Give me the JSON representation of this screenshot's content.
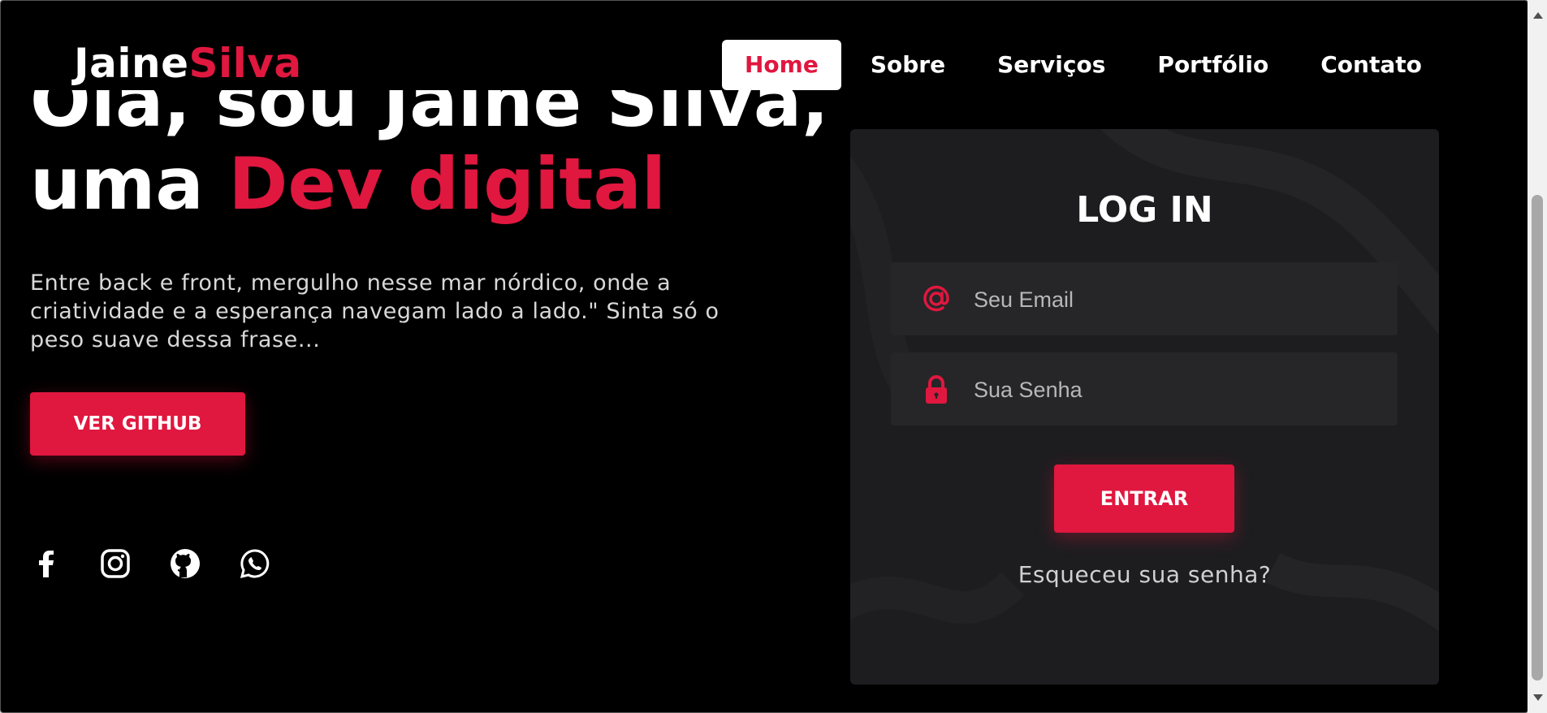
{
  "header": {
    "logo": {
      "first": "Jaine",
      "second": "Silva"
    },
    "nav": [
      {
        "label": "Home",
        "active": true
      },
      {
        "label": "Sobre"
      },
      {
        "label": "Serviços"
      },
      {
        "label": "Portfólio"
      },
      {
        "label": "Contato"
      }
    ]
  },
  "hero": {
    "title_line1": "Olá, sou Jaine Silva,",
    "title_line2_prefix": "uma ",
    "title_line2_accent": "Dev digital",
    "description": "Entre back e front, mergulho nesse mar nórdico, onde a criatividade e a esperança navegam lado a lado.\" Sinta só o peso suave dessa frase...",
    "button_label": "VER GITHUB",
    "socials": [
      "facebook-icon",
      "instagram-icon",
      "github-icon",
      "whatsapp-icon"
    ]
  },
  "login": {
    "title": "LOG IN",
    "email_placeholder": "Seu Email",
    "password_placeholder": "Sua Senha",
    "submit_label": "ENTRAR",
    "forgot_label": "Esqueceu sua senha?"
  },
  "colors": {
    "accent": "#e0173f",
    "background": "#000000",
    "card": "#1d1d1f",
    "field": "#262628"
  }
}
